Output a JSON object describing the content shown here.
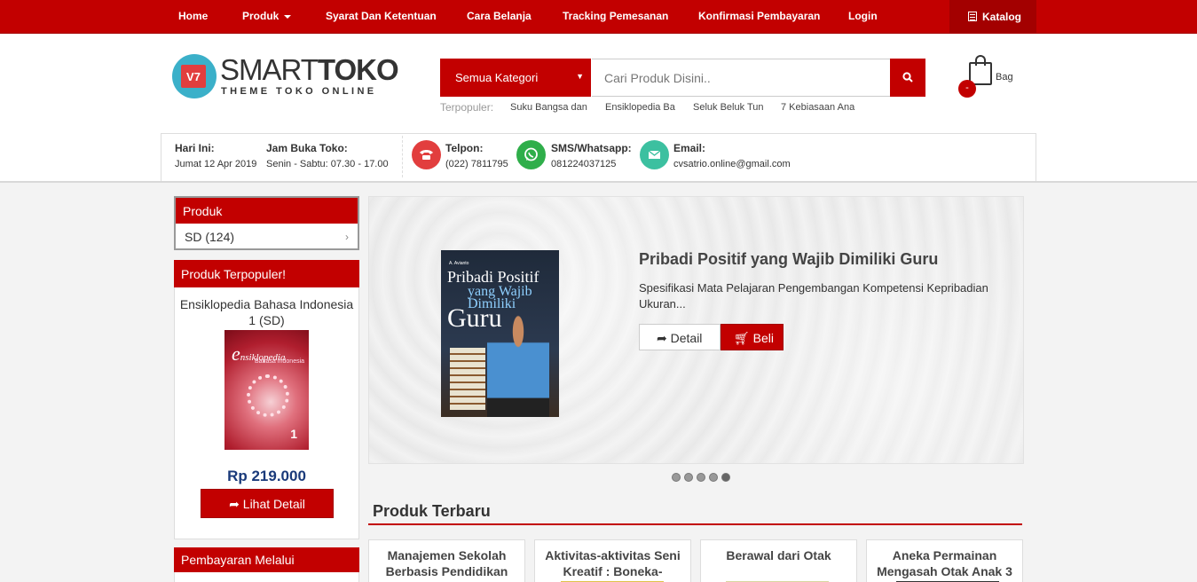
{
  "topnav": {
    "items": [
      {
        "label": "Home"
      },
      {
        "label": "Produk"
      },
      {
        "label": "Syarat Dan Ketentuan"
      },
      {
        "label": "Cara Belanja"
      },
      {
        "label": "Tracking Pemesanan"
      },
      {
        "label": "Konfirmasi Pembayaran"
      },
      {
        "label": "Login"
      }
    ],
    "katalog_label": "Katalog"
  },
  "logo": {
    "badge": "V7",
    "name_light": "SMART",
    "name_bold": "TOKO",
    "tagline": "THEME TOKO ONLINE"
  },
  "search": {
    "category_label": "Semua Kategori",
    "placeholder": "Cari Produk Disini..",
    "popular_label": "Terpopuler:",
    "popular_links": [
      "Suku Bangsa dan",
      "Ensiklopedia Ba",
      "Seluk Beluk Tun",
      "7 Kebiasaan Ana"
    ]
  },
  "cart": {
    "label": "Bag",
    "count": "-"
  },
  "info": {
    "today_label": "Hari Ini:",
    "today_value": "Jumat 12 Apr 2019",
    "hours_label": "Jam Buka Toko:",
    "hours_value": "Senin - Sabtu: 07.30 - 17.00",
    "phone_label": "Telpon:",
    "phone_value": "(022) 7811795",
    "sms_label": "SMS/Whatsapp:",
    "sms_value": "081224037125",
    "email_label": "Email:",
    "email_value": "cvsatrio.online@gmail.com"
  },
  "sidebar": {
    "produk_title": "Produk",
    "produk_item": "SD (124)",
    "popular_title": "Produk Terpopuler!",
    "popular_name": "Ensiklopedia Bahasa Indonesia 1 (SD)",
    "popular_cover_title": "nsiklopedia",
    "popular_cover_sub": "Bahasa Indonesia",
    "popular_cover_num": "1",
    "popular_price": "Rp 219.000",
    "popular_button": "Lihat Detail",
    "payment_title": "Pembayaran Melalui"
  },
  "slider": {
    "cover_author": "A. Avianto",
    "cover_line1": "Pribadi Positif",
    "cover_line2": "yang Wajib",
    "cover_line3": "Dimiliki",
    "cover_line4": "Guru",
    "title": "Pribadi Positif yang Wajib Dimiliki Guru",
    "description": "Spesifikasi Mata Pelajaran Pengembangan Kompetensi Kepribadian Ukuran...",
    "detail_button": "Detail",
    "buy_button": "Beli",
    "dot_count": 5,
    "active_dot": 5
  },
  "newest": {
    "title": "Produk Terbaru",
    "products": [
      {
        "name": "Manajemen Sekolah Berbasis Pendidikan"
      },
      {
        "name": "Aktivitas-aktivitas Seni Kreatif : Boneka-Boneka"
      },
      {
        "name": "Berawal dari Otak"
      },
      {
        "name": "Aneka Permainan Mengasah Otak Anak 3"
      }
    ]
  },
  "colors": {
    "brand_red": "#c20000",
    "dark_red": "#a30000",
    "phone_icon": "#e23e3e",
    "whatsapp_icon": "#2fae4a",
    "email_icon": "#3cc0a0",
    "price_blue": "#1a3a7a"
  }
}
